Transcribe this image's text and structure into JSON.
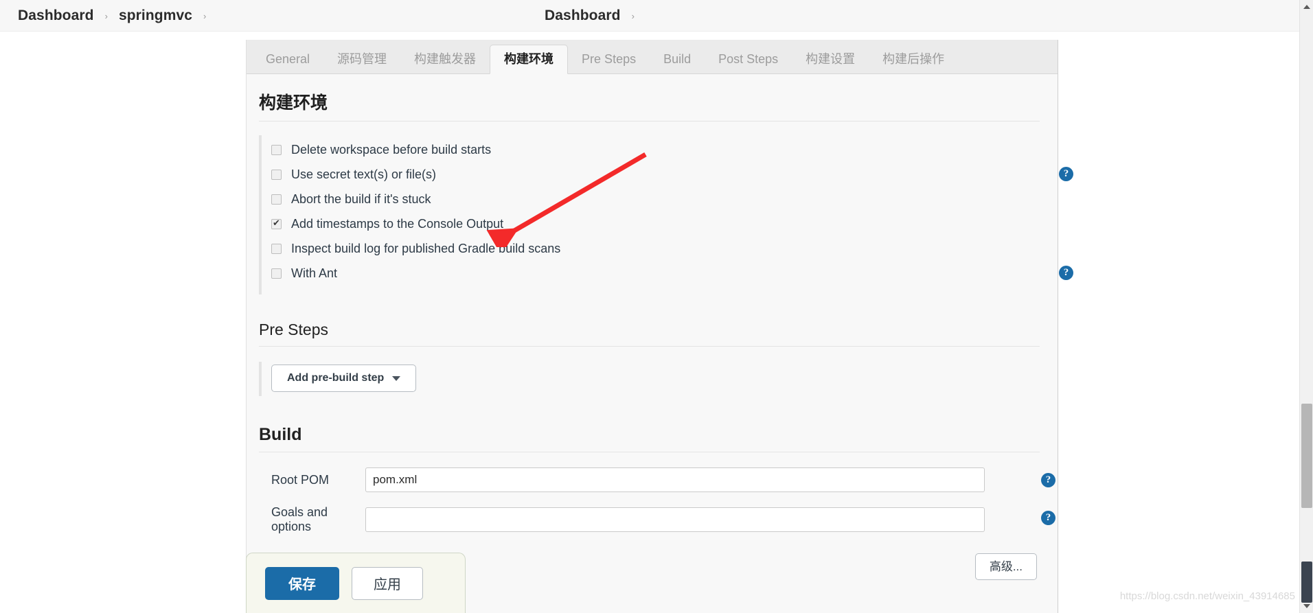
{
  "breadcrumb": {
    "left": [
      "Dashboard",
      "springmvc"
    ],
    "center": [
      "Dashboard"
    ],
    "separator": "›"
  },
  "tabs": [
    {
      "label": "General",
      "active": false
    },
    {
      "label": "源码管理",
      "active": false
    },
    {
      "label": "构建触发器",
      "active": false
    },
    {
      "label": "构建环境",
      "active": true
    },
    {
      "label": "Pre Steps",
      "active": false
    },
    {
      "label": "Build",
      "active": false
    },
    {
      "label": "Post Steps",
      "active": false
    },
    {
      "label": "构建设置",
      "active": false
    },
    {
      "label": "构建后操作",
      "active": false
    }
  ],
  "build_environment": {
    "title": "构建环境",
    "options": [
      {
        "label": "Delete workspace before build starts",
        "checked": false,
        "help": false
      },
      {
        "label": "Use secret text(s) or file(s)",
        "checked": false,
        "help": true
      },
      {
        "label": "Abort the build if it's stuck",
        "checked": false,
        "help": false
      },
      {
        "label": "Add timestamps to the Console Output",
        "checked": true,
        "help": false
      },
      {
        "label": "Inspect build log for published Gradle build scans",
        "checked": false,
        "help": false
      },
      {
        "label": "With Ant",
        "checked": false,
        "help": true
      }
    ]
  },
  "pre_steps": {
    "title": "Pre Steps",
    "add_button_label": "Add pre-build step"
  },
  "build": {
    "title": "Build",
    "fields": [
      {
        "label": "Root POM",
        "value": "pom.xml",
        "placeholder": "",
        "help": true
      },
      {
        "label": "Goals and options",
        "value": "",
        "placeholder": "",
        "help": true
      }
    ],
    "advanced_label": "高级..."
  },
  "actions": {
    "save_label": "保存",
    "apply_label": "应用"
  },
  "icons": {
    "help": "?"
  },
  "watermark": "https://blog.csdn.net/weixin_43914685",
  "colors": {
    "accent": "#1b6ca8",
    "annotation_arrow": "#f32a2a",
    "panel_bg": "#f8f8f8",
    "tabbar_bg": "#ebebeb"
  }
}
